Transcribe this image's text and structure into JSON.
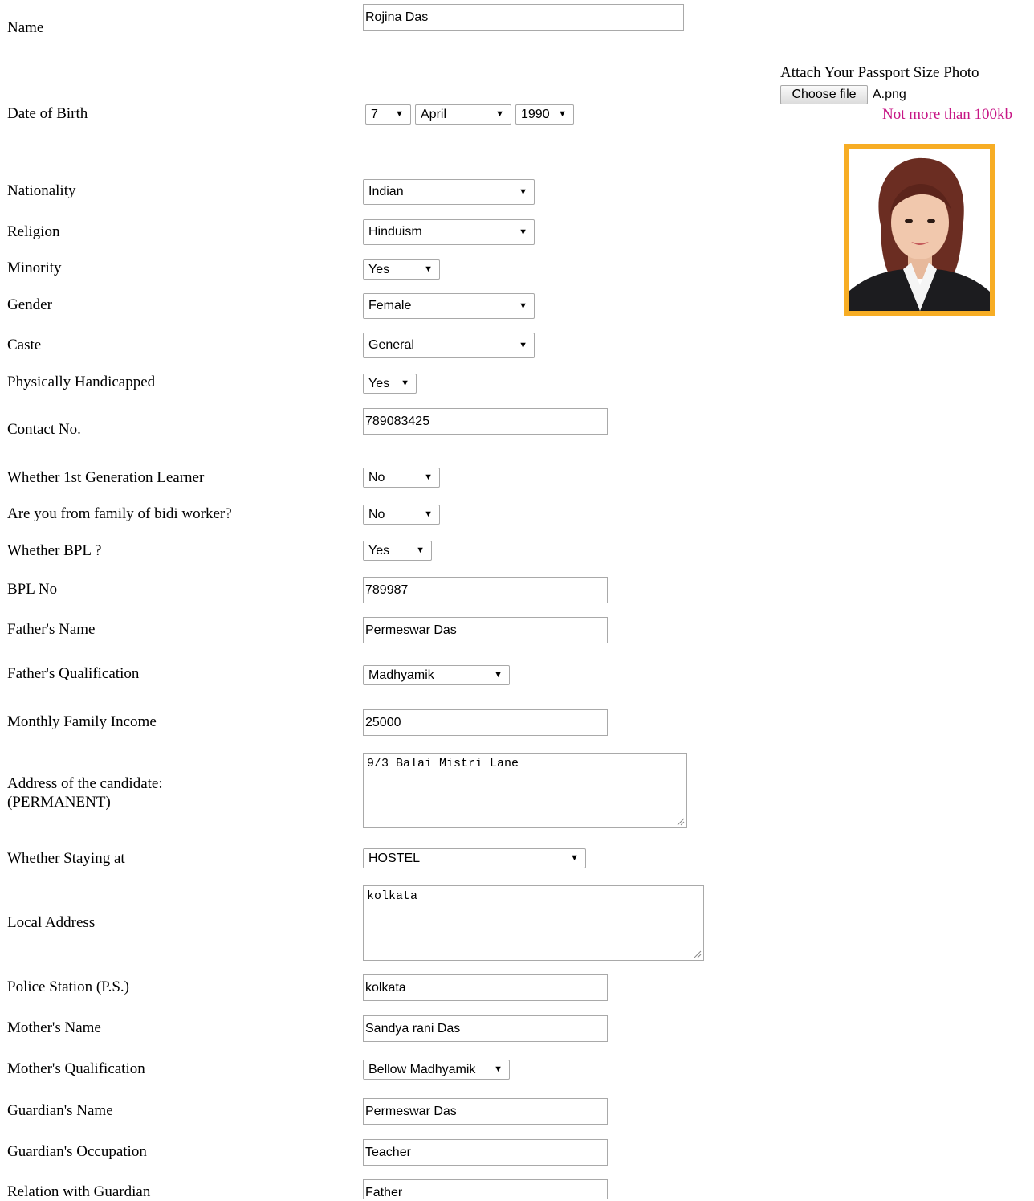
{
  "photo": {
    "label": "Attach Your Passport Size Photo",
    "button": "Choose file",
    "filename": "A.png",
    "note": "Not more than 100kb",
    "frame_color": "#f7ad24",
    "note_color": "#c71585"
  },
  "labels": {
    "name": "Name",
    "dob": "Date of Birth",
    "nationality": "Nationality",
    "religion": "Religion",
    "minority": "Minority",
    "gender": "Gender",
    "caste": "Caste",
    "handicapped": "Physically Handicapped",
    "contact": "Contact No.",
    "first_gen": "Whether 1st Generation Learner",
    "bidi": "Are you from family of bidi worker?",
    "bpl": "Whether BPL ?",
    "bpl_no": "BPL No",
    "father_name": "Father's Name",
    "father_qual": "Father's Qualification",
    "income": "Monthly Family Income",
    "address_line1": "Address of the candidate:",
    "address_line2": "(PERMANENT)",
    "staying": "Whether Staying at",
    "local_address": "Local Address",
    "police_station": "Police Station (P.S.)",
    "mother_name": "Mother's Name",
    "mother_qual": "Mother's Qualification",
    "guardian_name": "Guardian's Name",
    "guardian_occupation": "Guardian's Occupation",
    "relation": "Relation with Guardian"
  },
  "values": {
    "name": "Rojina Das",
    "dob_day": "7",
    "dob_month": "April",
    "dob_year": "1990",
    "nationality": "Indian",
    "religion": "Hinduism",
    "minority": "Yes",
    "gender": "Female",
    "caste": "General",
    "handicapped": "Yes",
    "contact": "789083425",
    "first_gen": "No",
    "bidi": "No",
    "bpl": "Yes",
    "bpl_no": "789987",
    "father_name": "Permeswar Das",
    "father_qual": "Madhyamik",
    "income": "25000",
    "address": "9/3 Balai Mistri Lane",
    "staying": "HOSTEL",
    "local_address": "kolkata",
    "police_station": "kolkata",
    "mother_name": "Sandya rani Das",
    "mother_qual": "Bellow Madhyamik",
    "guardian_name": "Permeswar Das",
    "guardian_occupation": "Teacher",
    "relation": "Father"
  },
  "icons": {
    "select_arrow": "▼",
    "resize_grip": "resize-grip-icon"
  }
}
